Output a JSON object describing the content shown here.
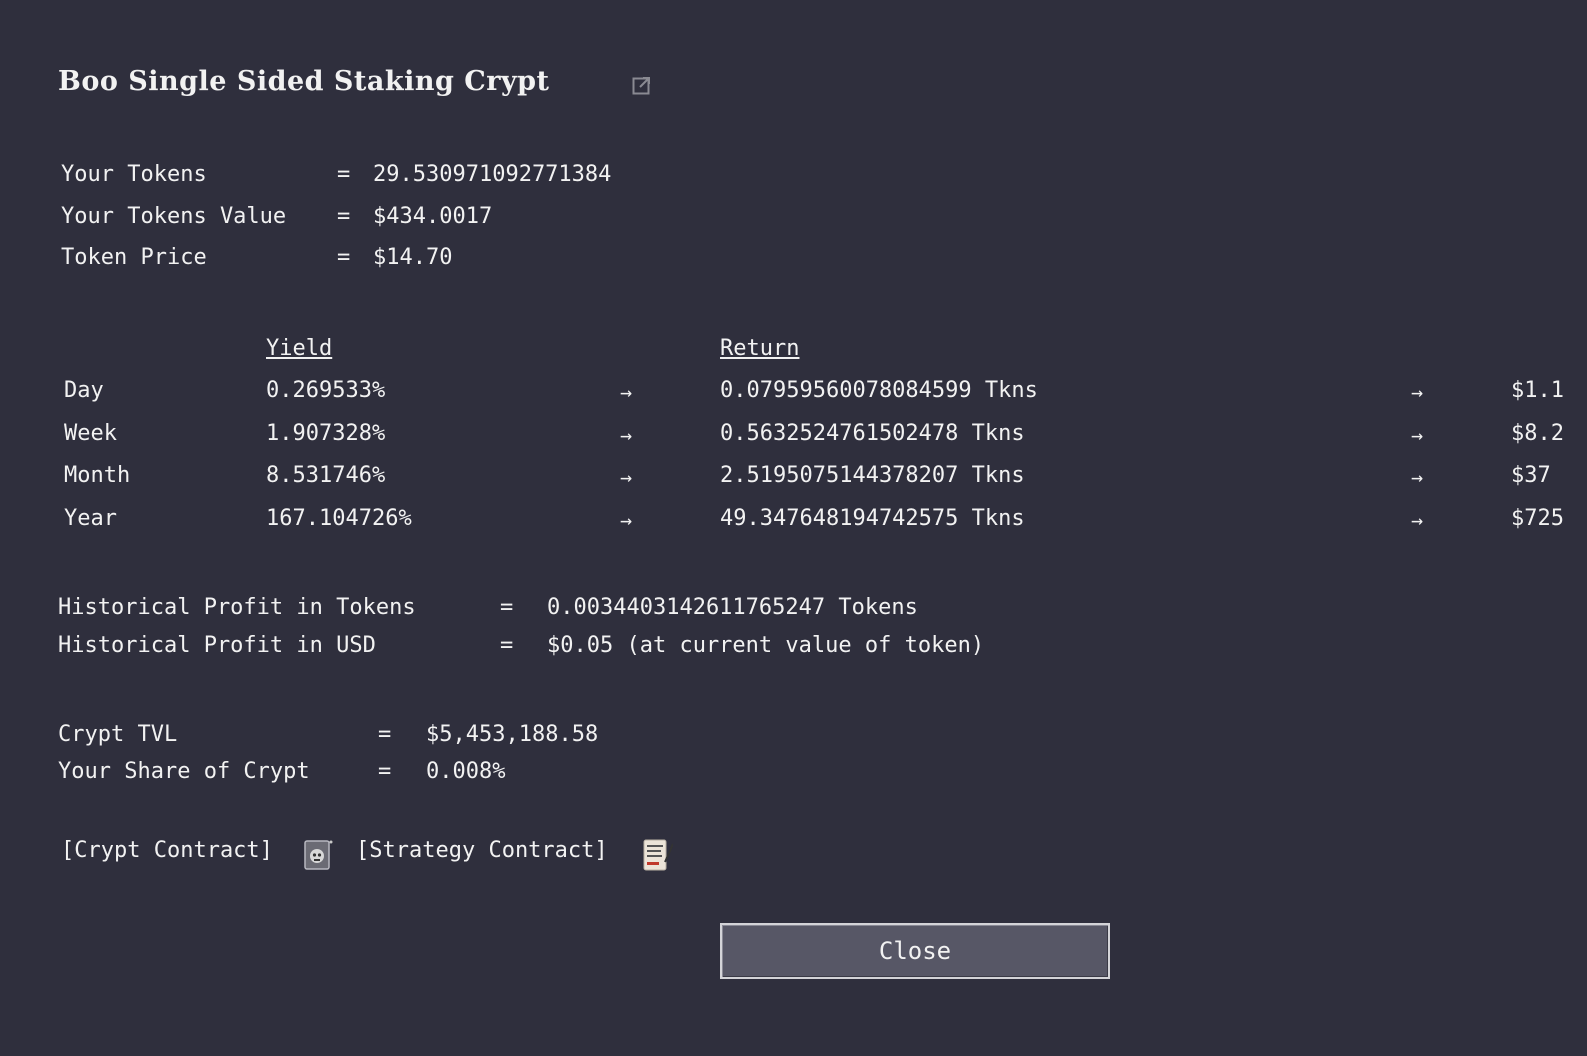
{
  "title": "Boo Single Sided Staking Crypt",
  "summary": {
    "tokens_label": "Your Tokens",
    "tokens_value": "29.530971092771384",
    "tokens_value_label": "Your Tokens Value",
    "tokens_value_value": "$434.0017",
    "token_price_label": "Token Price",
    "token_price_value": "$14.70",
    "eq": "="
  },
  "yield_table": {
    "yield_header": "Yield",
    "return_header": "Return",
    "arrow": "→",
    "rows": [
      {
        "period": "Day",
        "yield": "0.269533%",
        "return": "0.07959560078084599 Tkns",
        "usd": "$1.1"
      },
      {
        "period": "Week",
        "yield": "1.907328%",
        "return": "0.563252476150247​8 Tkns",
        "usd": "$8.2"
      },
      {
        "period": "Month",
        "yield": "8.531746%",
        "return": "2.5195075144378207 Tkns",
        "usd": "$37"
      },
      {
        "period": "Year",
        "yield": "167.104726%",
        "return": "49.347648194742575 Tkns",
        "usd": "$725"
      }
    ]
  },
  "historical": {
    "tokens_label": "Historical Profit in Tokens",
    "tokens_value": "0.0034403142611765247 Tokens",
    "usd_label": "Historical Profit in USD",
    "usd_value": "$0.05 (at current value of token)",
    "eq": "="
  },
  "crypt": {
    "tvl_label": "Crypt TVL",
    "tvl_value": "$5,453,188.58",
    "share_label": "Your Share of Crypt",
    "share_value": "0.008%",
    "eq": "="
  },
  "links": {
    "crypt_contract": "[Crypt Contract]",
    "strategy_contract": "[Strategy Contract]"
  },
  "close_label": "Close"
}
